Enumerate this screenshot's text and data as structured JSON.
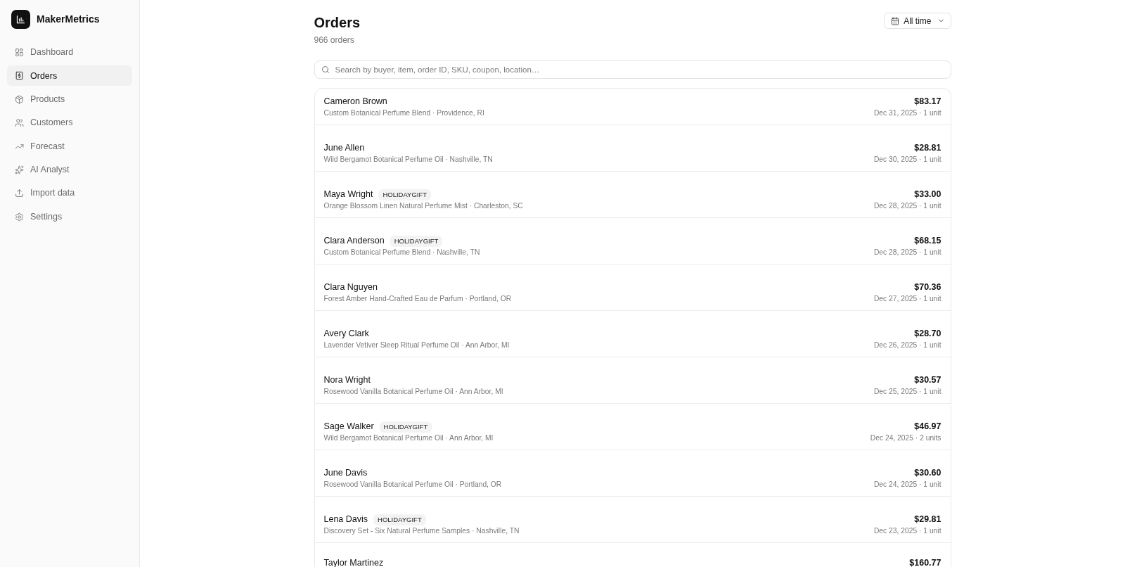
{
  "app": {
    "name": "MakerMetrics"
  },
  "sidebar": {
    "items": [
      {
        "label": "Dashboard",
        "selected": false
      },
      {
        "label": "Orders",
        "selected": true
      },
      {
        "label": "Products",
        "selected": false
      },
      {
        "label": "Customers",
        "selected": false
      },
      {
        "label": "Forecast",
        "selected": false
      },
      {
        "label": "AI Analyst",
        "selected": false
      },
      {
        "label": "Import data",
        "selected": false
      },
      {
        "label": "Settings",
        "selected": false
      }
    ]
  },
  "header": {
    "title": "Orders",
    "count": "966 orders",
    "date_filter": "All time"
  },
  "search": {
    "placeholder": "Search by buyer, item, order ID, SKU, coupon, location…"
  },
  "orders": [
    {
      "name": "Cameron Brown",
      "detail": "Custom Botanical Perfume Blend · Providence, RI",
      "total": "$83.17",
      "meta": "Dec 31, 2025 · 1 unit"
    },
    {
      "name": "June Allen",
      "detail": "Wild Bergamot Botanical Perfume Oil · Nashville, TN",
      "total": "$28.81",
      "meta": "Dec 30, 2025 · 1 unit"
    },
    {
      "name": "Maya Wright",
      "coupon": "HOLIDAYGIFT",
      "detail": "Orange Blossom Linen Natural Perfume Mist · Charleston, SC",
      "total": "$33.00",
      "meta": "Dec 28, 2025 · 1 unit"
    },
    {
      "name": "Clara Anderson",
      "coupon": "HOLIDAYGIFT",
      "detail": "Custom Botanical Perfume Blend · Nashville, TN",
      "total": "$68.15",
      "meta": "Dec 28, 2025 · 1 unit"
    },
    {
      "name": "Clara Nguyen",
      "detail": "Forest Amber Hand-Crafted Eau de Parfum · Portland, OR",
      "total": "$70.36",
      "meta": "Dec 27, 2025 · 1 unit"
    },
    {
      "name": "Avery Clark",
      "detail": "Lavender Vetiver Sleep Ritual Perfume Oil · Ann Arbor, MI",
      "total": "$28.70",
      "meta": "Dec 26, 2025 · 1 unit"
    },
    {
      "name": "Nora Wright",
      "detail": "Rosewood Vanilla Botanical Perfume Oil · Ann Arbor, MI",
      "total": "$30.57",
      "meta": "Dec 25, 2025 · 1 unit"
    },
    {
      "name": "Sage Walker",
      "coupon": "HOLIDAYGIFT",
      "detail": "Wild Bergamot Botanical Perfume Oil · Ann Arbor, MI",
      "total": "$46.97",
      "meta": "Dec 24, 2025 · 2 units"
    },
    {
      "name": "June Davis",
      "detail": "Rosewood Vanilla Botanical Perfume Oil · Portland, OR",
      "total": "$30.60",
      "meta": "Dec 24, 2025 · 1 unit"
    },
    {
      "name": "Lena Davis",
      "coupon": "HOLIDAYGIFT",
      "detail": "Discovery Set - Six Natural Perfume Samples · Nashville, TN",
      "total": "$29.81",
      "meta": "Dec 23, 2025 · 1 unit"
    },
    {
      "name": "Taylor Martinez",
      "total": "$160.77"
    }
  ]
}
